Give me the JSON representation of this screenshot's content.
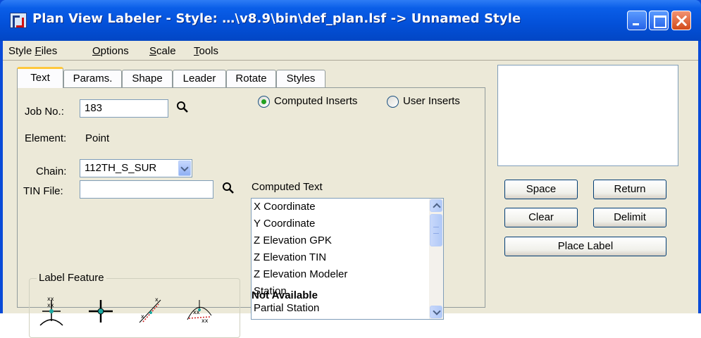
{
  "window": {
    "title": "Plan View Labeler - Style: …\\v8.9\\bin\\def_plan.lsf -> Unnamed Style"
  },
  "menu": [
    {
      "pre": "Style ",
      "acc": "F",
      "post": "iles"
    },
    {
      "pre": "",
      "acc": "O",
      "post": "ptions"
    },
    {
      "pre": "",
      "acc": "S",
      "post": "cale"
    },
    {
      "pre": "",
      "acc": "T",
      "post": "ools"
    }
  ],
  "tabs": [
    {
      "label": "Text",
      "active": true
    },
    {
      "label": "Params.",
      "active": false
    },
    {
      "label": "Shape",
      "active": false
    },
    {
      "label": "Leader",
      "active": false
    },
    {
      "label": "Rotate",
      "active": false
    },
    {
      "label": "Styles",
      "active": false
    }
  ],
  "text_tab": {
    "job_label": "Job No.:",
    "job_value": "183",
    "element_label": "Element:",
    "element_value": "Point",
    "chain_label": "Chain:",
    "chain_value": "112TH_S_SUR",
    "tin_label": "TIN File:",
    "tin_value": "",
    "label_feature_title": "Label Feature",
    "radio_computed": "Computed Inserts",
    "radio_user": "User Inserts",
    "radio_selected": "computed",
    "computed_text_label": "Computed Text",
    "computed_items": [
      "X Coordinate",
      "Y Coordinate",
      "Z Elevation GPK",
      "Z Elevation TIN",
      "Z Elevation Modeler",
      "Station",
      "Partial Station"
    ],
    "status": "Not Available"
  },
  "buttons": {
    "space": "Space",
    "return": "Return",
    "clear": "Clear",
    "delimit": "Delimit",
    "place_label": "Place Label"
  },
  "colors": {
    "title_bar": "#0350d8",
    "dialog_face": "#ece9d8",
    "active_tab_highlight": "#ffc83c",
    "radio_dot": "#21a121"
  }
}
